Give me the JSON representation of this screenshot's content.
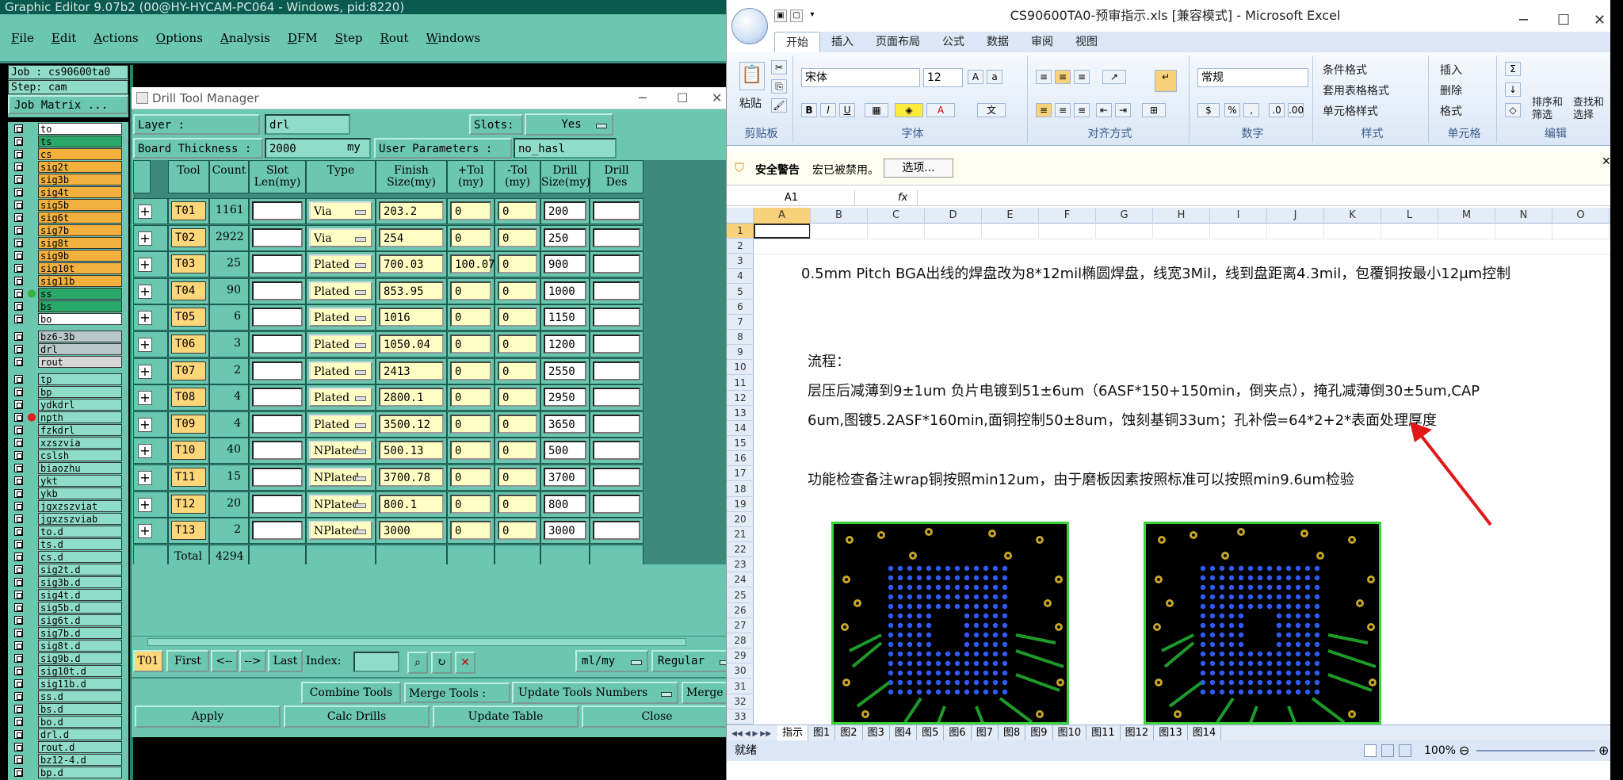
{
  "genesis": {
    "title": "Graphic Editor 9.07b2 (00@HY-HYCAM-PC064 - Windows, pid:8220)",
    "menu": [
      "File",
      "Edit",
      "Actions",
      "Options",
      "Analysis",
      "DFM",
      "Step",
      "Rout",
      "Windows"
    ],
    "job": "Job : cs90600ta0",
    "step": "Step: cam",
    "job_matrix": "Job Matrix ...",
    "layers": [
      {
        "name": "to",
        "color": "#ffffff",
        "gap": false
      },
      {
        "name": "ts",
        "color": "#2aa86a",
        "gap": false
      },
      {
        "name": "cs",
        "color": "#f2b03c",
        "gap": false
      },
      {
        "name": "sig2t",
        "color": "#f2b03c",
        "gap": false
      },
      {
        "name": "sig3b",
        "color": "#f2b03c",
        "gap": false
      },
      {
        "name": "sig4t",
        "color": "#f2b03c",
        "gap": false
      },
      {
        "name": "sig5b",
        "color": "#f2b03c",
        "gap": false
      },
      {
        "name": "sig6t",
        "color": "#f2b03c",
        "gap": false
      },
      {
        "name": "sig7b",
        "color": "#f2b03c",
        "gap": false
      },
      {
        "name": "sig8t",
        "color": "#f2b03c",
        "gap": false
      },
      {
        "name": "sig9b",
        "color": "#f2b03c",
        "gap": false
      },
      {
        "name": "sig10t",
        "color": "#f2b03c",
        "gap": false
      },
      {
        "name": "sig11b",
        "color": "#f2b03c",
        "gap": false
      },
      {
        "name": "ss",
        "color": "#2aa86a",
        "gap": false,
        "dot": "#3ab03a"
      },
      {
        "name": "bs",
        "color": "#2aa86a",
        "gap": false
      },
      {
        "name": "bo",
        "color": "#ffffff",
        "gap": false
      },
      {
        "name": "bz6-3b",
        "color": "#b8c8c8",
        "gap": true
      },
      {
        "name": "drl",
        "color": "#b8c8c8",
        "gap": false
      },
      {
        "name": "rout",
        "color": "#d8d8d8",
        "gap": false
      },
      {
        "name": "tp",
        "color": "#8fdcc8",
        "gap": true
      },
      {
        "name": "bp",
        "color": "#8fdcc8",
        "gap": false
      },
      {
        "name": "ydkdrl",
        "color": "#8fdcc8",
        "gap": false
      },
      {
        "name": "npth",
        "color": "#8fdcc8",
        "gap": false,
        "dot": "#e02020"
      },
      {
        "name": "fzkdrl",
        "color": "#8fdcc8",
        "gap": false
      },
      {
        "name": "xzszvia",
        "color": "#8fdcc8",
        "gap": false
      },
      {
        "name": "cslsh",
        "color": "#8fdcc8",
        "gap": false
      },
      {
        "name": "biaozhu",
        "color": "#8fdcc8",
        "gap": false
      },
      {
        "name": "ykt",
        "color": "#8fdcc8",
        "gap": false
      },
      {
        "name": "ykb",
        "color": "#8fdcc8",
        "gap": false
      },
      {
        "name": "jgxzszviat",
        "color": "#8fdcc8",
        "gap": false
      },
      {
        "name": "jgxzszviab",
        "color": "#8fdcc8",
        "gap": false
      },
      {
        "name": "to.d",
        "color": "#8fdcc8",
        "gap": false
      },
      {
        "name": "ts.d",
        "color": "#8fdcc8",
        "gap": false
      },
      {
        "name": "cs.d",
        "color": "#8fdcc8",
        "gap": false
      },
      {
        "name": "sig2t.d",
        "color": "#8fdcc8",
        "gap": false
      },
      {
        "name": "sig3b.d",
        "color": "#8fdcc8",
        "gap": false
      },
      {
        "name": "sig4t.d",
        "color": "#8fdcc8",
        "gap": false
      },
      {
        "name": "sig5b.d",
        "color": "#8fdcc8",
        "gap": false
      },
      {
        "name": "sig6t.d",
        "color": "#8fdcc8",
        "gap": false
      },
      {
        "name": "sig7b.d",
        "color": "#8fdcc8",
        "gap": false
      },
      {
        "name": "sig8t.d",
        "color": "#8fdcc8",
        "gap": false
      },
      {
        "name": "sig9b.d",
        "color": "#8fdcc8",
        "gap": false
      },
      {
        "name": "sig10t.d",
        "color": "#8fdcc8",
        "gap": false
      },
      {
        "name": "sig11b.d",
        "color": "#8fdcc8",
        "gap": false
      },
      {
        "name": "ss.d",
        "color": "#8fdcc8",
        "gap": false
      },
      {
        "name": "bs.d",
        "color": "#8fdcc8",
        "gap": false
      },
      {
        "name": "bo.d",
        "color": "#8fdcc8",
        "gap": false
      },
      {
        "name": "drl.d",
        "color": "#8fdcc8",
        "gap": false
      },
      {
        "name": "rout.d",
        "color": "#8fdcc8",
        "gap": false
      },
      {
        "name": "bz12-4.d",
        "color": "#8fdcc8",
        "gap": false
      },
      {
        "name": "bp.d",
        "color": "#8fdcc8",
        "gap": false
      }
    ]
  },
  "dtm": {
    "title": "Drill Tool Manager",
    "layer_label": "Layer          :",
    "layer_value": "drl",
    "slots_label": "Slots:",
    "slots_value": "Yes",
    "thickness_label": "Board Thickness :",
    "thickness_value": "2000",
    "thickness_unit": "my",
    "user_params_label": "User Parameters :",
    "user_params_value": "no_hasl",
    "headers": [
      "Tool",
      "Count",
      "Slot\nLen(my)",
      "Type",
      "Finish\nSize(my)",
      "+Tol\n(my)",
      "-Tol\n(my)",
      "Drill\nSize(my)",
      "Drill\nDes"
    ],
    "rows": [
      {
        "tool": "T01",
        "count": "1161",
        "type": "Via",
        "finish": "203.2",
        "ptol": "0",
        "mtol": "0",
        "drill": "200"
      },
      {
        "tool": "T02",
        "count": "2922",
        "type": "Via",
        "finish": "254",
        "ptol": "0",
        "mtol": "0",
        "drill": "250"
      },
      {
        "tool": "T03",
        "count": "25",
        "type": "Plated",
        "finish": "700.03",
        "ptol": "100.07",
        "mtol": "0",
        "drill": "900"
      },
      {
        "tool": "T04",
        "count": "90",
        "type": "Plated",
        "finish": "853.95",
        "ptol": "0",
        "mtol": "0",
        "drill": "1000"
      },
      {
        "tool": "T05",
        "count": "6",
        "type": "Plated",
        "finish": "1016",
        "ptol": "0",
        "mtol": "0",
        "drill": "1150"
      },
      {
        "tool": "T06",
        "count": "3",
        "type": "Plated",
        "finish": "1050.04",
        "ptol": "0",
        "mtol": "0",
        "drill": "1200"
      },
      {
        "tool": "T07",
        "count": "2",
        "type": "Plated",
        "finish": "2413",
        "ptol": "0",
        "mtol": "0",
        "drill": "2550"
      },
      {
        "tool": "T08",
        "count": "4",
        "type": "Plated",
        "finish": "2800.1",
        "ptol": "0",
        "mtol": "0",
        "drill": "2950"
      },
      {
        "tool": "T09",
        "count": "4",
        "type": "Plated",
        "finish": "3500.12",
        "ptol": "0",
        "mtol": "0",
        "drill": "3650"
      },
      {
        "tool": "T10",
        "count": "40",
        "type": "NPlated",
        "finish": "500.13",
        "ptol": "0",
        "mtol": "0",
        "drill": "500"
      },
      {
        "tool": "T11",
        "count": "15",
        "type": "NPlated",
        "finish": "3700.78",
        "ptol": "0",
        "mtol": "0",
        "drill": "3700"
      },
      {
        "tool": "T12",
        "count": "20",
        "type": "NPlated",
        "finish": "800.1",
        "ptol": "0",
        "mtol": "0",
        "drill": "800"
      },
      {
        "tool": "T13",
        "count": "2",
        "type": "NPlated",
        "finish": "3000",
        "ptol": "0",
        "mtol": "0",
        "drill": "3000"
      }
    ],
    "total_label": "Total",
    "total_value": "4294",
    "current_tool": "T01",
    "first": "First",
    "prev": "<--",
    "next": "-->",
    "last": "Last",
    "index_label": "Index:",
    "units": "ml/my",
    "mode": "Regular",
    "combine": "Combine Tools",
    "merge_label": "Merge Tools :",
    "update_numbers": "Update Tools Numbers",
    "merge_trunc": "Merge",
    "apply": "Apply",
    "calc": "Calc Drills",
    "update_table": "Update Table",
    "close": "Close"
  },
  "excel": {
    "title": "CS90600TA0-预审指示.xls  [兼容模式] - Microsoft Excel",
    "tabs": [
      "开始",
      "插入",
      "页面布局",
      "公式",
      "数据",
      "审阅",
      "视图"
    ],
    "paste": "粘贴",
    "font_name": "宋体",
    "font_size": "12",
    "number_format": "常规",
    "cond_format": "条件格式",
    "table_format": "套用表格格式",
    "cell_style": "单元格样式",
    "insert": "插入",
    "delete": "删除",
    "format": "格式",
    "sort": "排序和\n筛选",
    "find": "查找和\n选择",
    "groups": [
      "剪贴板",
      "字体",
      "对齐方式",
      "数字",
      "样式",
      "单元格",
      "编辑"
    ],
    "security_label": "安全警告",
    "security_text": "宏已被禁用。",
    "options_btn": "选项...",
    "name_box": "A1",
    "fx": "fx",
    "columns": [
      "A",
      "B",
      "C",
      "D",
      "E",
      "F",
      "G",
      "H",
      "I",
      "J",
      "K",
      "L",
      "M",
      "N",
      "O"
    ],
    "row_numbers": [
      "1",
      "2",
      "3",
      "4",
      "5",
      "6",
      "7",
      "8",
      "9",
      "10",
      "11",
      "12",
      "13",
      "14",
      "15",
      "16",
      "17",
      "18",
      "19",
      "20",
      "21",
      "22",
      "23",
      "24",
      "25",
      "26",
      "27",
      "28",
      "29",
      "30",
      "31",
      "32",
      "33"
    ],
    "lines": [
      "0.5mm Pitch BGA出线的焊盘改为8*12mil椭圆焊盘，线宽3Mil，线到盘距离4.3mil，包覆铜按最小12μm控制",
      "流程：",
      "层压后减薄到9±1um  负片电镀到51±6um（6ASF*150+150min，倒夹点），掩孔减薄倒30±5um,CAP",
      "6um,图镀5.2ASF*160min,面铜控制50±8um，蚀刻基铜33um；孔补偿=64*2+2*表面处理厚度",
      "功能检查备注wrap铜按照min12um，由于磨板因素按照标准可以按照min9.6um检验"
    ],
    "sheet_tabs": [
      "指示",
      "图1",
      "图2",
      "图3",
      "图4",
      "图5",
      "图6",
      "图7",
      "图8",
      "图9",
      "图10",
      "图11",
      "图12",
      "图13",
      "图14"
    ],
    "status": "就绪",
    "zoom": "100%"
  }
}
